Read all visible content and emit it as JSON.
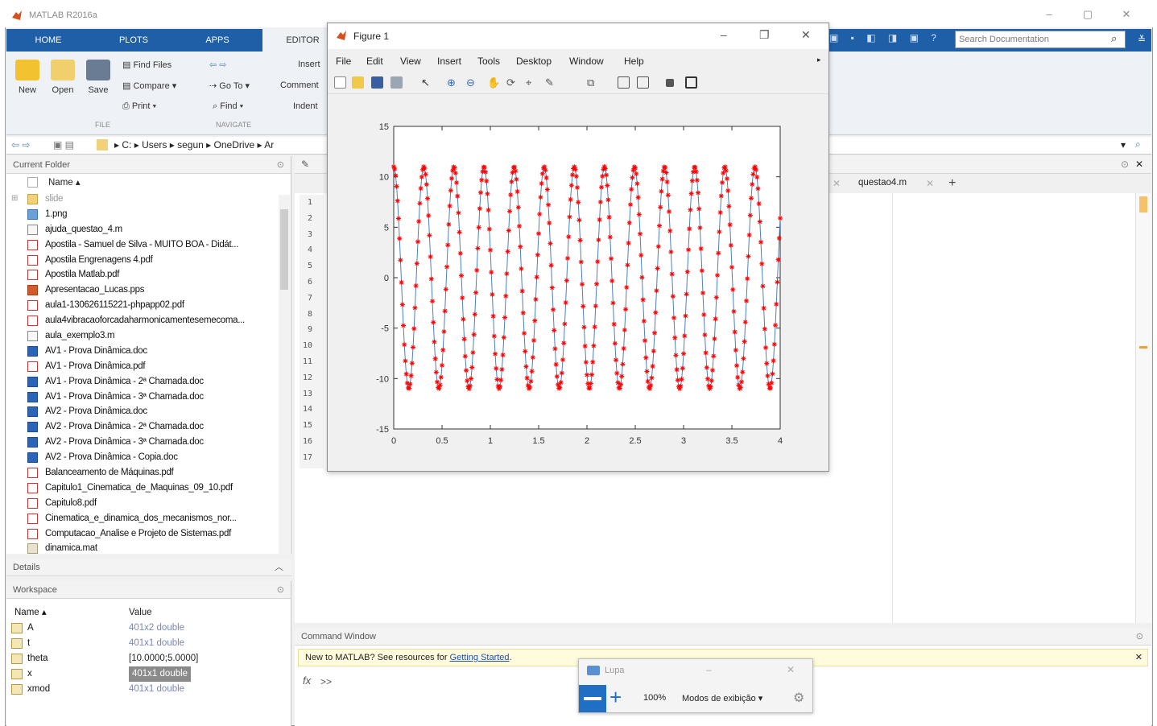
{
  "app": {
    "title": "MATLAB R2016a"
  },
  "ribbon": {
    "tabs": [
      "HOME",
      "PLOTS",
      "APPS",
      "EDITOR"
    ],
    "search_placeholder": "Search Documentation",
    "file_buttons": [
      "New",
      "Open",
      "Save"
    ],
    "find_files": "Find Files",
    "compare": "Compare",
    "print": "Print",
    "go_to": "Go To",
    "find": "Find",
    "insert": "Insert",
    "comment": "Comment",
    "indent": "Indent",
    "group_file": "FILE",
    "group_navigate": "NAVIGATE"
  },
  "address": {
    "segments": [
      "C:",
      "Users",
      "segun",
      "OneDrive",
      "Ar"
    ]
  },
  "current_folder": {
    "title": "Current Folder",
    "name_header": "Name",
    "files": [
      {
        "name": "slide",
        "type": "folder"
      },
      {
        "name": "1.png",
        "type": "png"
      },
      {
        "name": "ajuda_questao_4.m",
        "type": "m"
      },
      {
        "name": "Apostila - Samuel de Silva - MUITO BOA - Didát...",
        "type": "pdf"
      },
      {
        "name": "Apostila Engrenagens 4.pdf",
        "type": "pdf"
      },
      {
        "name": "Apostila Matlab.pdf",
        "type": "pdf"
      },
      {
        "name": "Apresentacao_Lucas.pps",
        "type": "pps"
      },
      {
        "name": "aula1-130626115221-phpapp02.pdf",
        "type": "pdf"
      },
      {
        "name": "aula4vibracaoforcadaharmonicamentesemecoma...",
        "type": "pdf"
      },
      {
        "name": "aula_exemplo3.m",
        "type": "m"
      },
      {
        "name": "AV1 - Prova Dinâmica.doc",
        "type": "doc"
      },
      {
        "name": "AV1 - Prova Dinâmica.pdf",
        "type": "pdf"
      },
      {
        "name": "AV1 - Prova Dinâmica - 2ª Chamada.doc",
        "type": "doc"
      },
      {
        "name": "AV1 - Prova Dinâmica - 3ª Chamada.doc",
        "type": "doc"
      },
      {
        "name": "AV2 - Prova Dinâmica.doc",
        "type": "doc"
      },
      {
        "name": "AV2 - Prova Dinâmica - 2ª Chamada.doc",
        "type": "doc"
      },
      {
        "name": "AV2 - Prova Dinâmica - 3ª Chamada.doc",
        "type": "doc"
      },
      {
        "name": "AV2 - Prova Dinâmica - Copia.doc",
        "type": "doc"
      },
      {
        "name": "Balanceamento de Máquinas.pdf",
        "type": "pdf"
      },
      {
        "name": "Capitulo1_Cinematica_de_Maquinas_09_10.pdf",
        "type": "pdf"
      },
      {
        "name": "Capitulo8.pdf",
        "type": "pdf"
      },
      {
        "name": "Cinematica_e_dinamica_dos_mecanismos_nor...",
        "type": "pdf"
      },
      {
        "name": "Computacao_Analise e Projeto de Sistemas.pdf",
        "type": "pdf"
      },
      {
        "name": "dinamica.mat",
        "type": "mat"
      }
    ]
  },
  "details": {
    "title": "Details"
  },
  "workspace": {
    "title": "Workspace",
    "name_header": "Name",
    "value_header": "Value",
    "vars": [
      {
        "name": "A",
        "value": "401x2 double"
      },
      {
        "name": "t",
        "value": "401x1 double"
      },
      {
        "name": "theta",
        "value": "[10.0000;5.0000]"
      },
      {
        "name": "x",
        "value": "401x1 double"
      },
      {
        "name": "xmod",
        "value": "401x1 double"
      }
    ]
  },
  "editor": {
    "tab_label": "questao4.m",
    "line_numbers": [
      "1",
      "2",
      "3",
      "4",
      "5",
      "6",
      "7",
      "8",
      "9",
      "10",
      "11",
      "12",
      "13",
      "14",
      "15",
      "16",
      "17"
    ]
  },
  "command_window": {
    "title": "Command Window",
    "info_text": "New to MATLAB? See resources for",
    "info_link": "Getting Started",
    "info_end": ".",
    "prompt": ">>"
  },
  "figure": {
    "title": "Figure 1",
    "menu": [
      "File",
      "Edit",
      "View",
      "Insert",
      "Tools",
      "Desktop",
      "Window",
      "Help"
    ]
  },
  "lupa": {
    "title": "Lupa",
    "zoom": "100%",
    "mode": "Modos de exibição"
  },
  "colors": {
    "ribbon_blue": "#1f5fa8",
    "series_line": "#4a7fc4",
    "series_marker": "#ff0000"
  },
  "chart_data": {
    "type": "line",
    "title": "",
    "xlabel": "",
    "ylabel": "",
    "xlim": [
      0,
      4
    ],
    "ylim": [
      -15,
      15
    ],
    "xticks": [
      "0",
      "0.5",
      "1",
      "1.5",
      "2",
      "2.5",
      "3",
      "3.5",
      "4"
    ],
    "yticks": [
      "15",
      "10",
      "5",
      "0",
      "-5",
      "-10",
      "-15"
    ],
    "series": [
      {
        "function": "x(t) = 11*cos(2*pi*3.21*t)",
        "amplitude": 11,
        "frequency_hz": 3.21,
        "t_start": 0,
        "t_end": 4,
        "n_points": 401,
        "marker": "*",
        "marker_color": "#ff0000",
        "line_color": "#4a7fc4"
      }
    ],
    "grid": false,
    "legend": "none"
  }
}
